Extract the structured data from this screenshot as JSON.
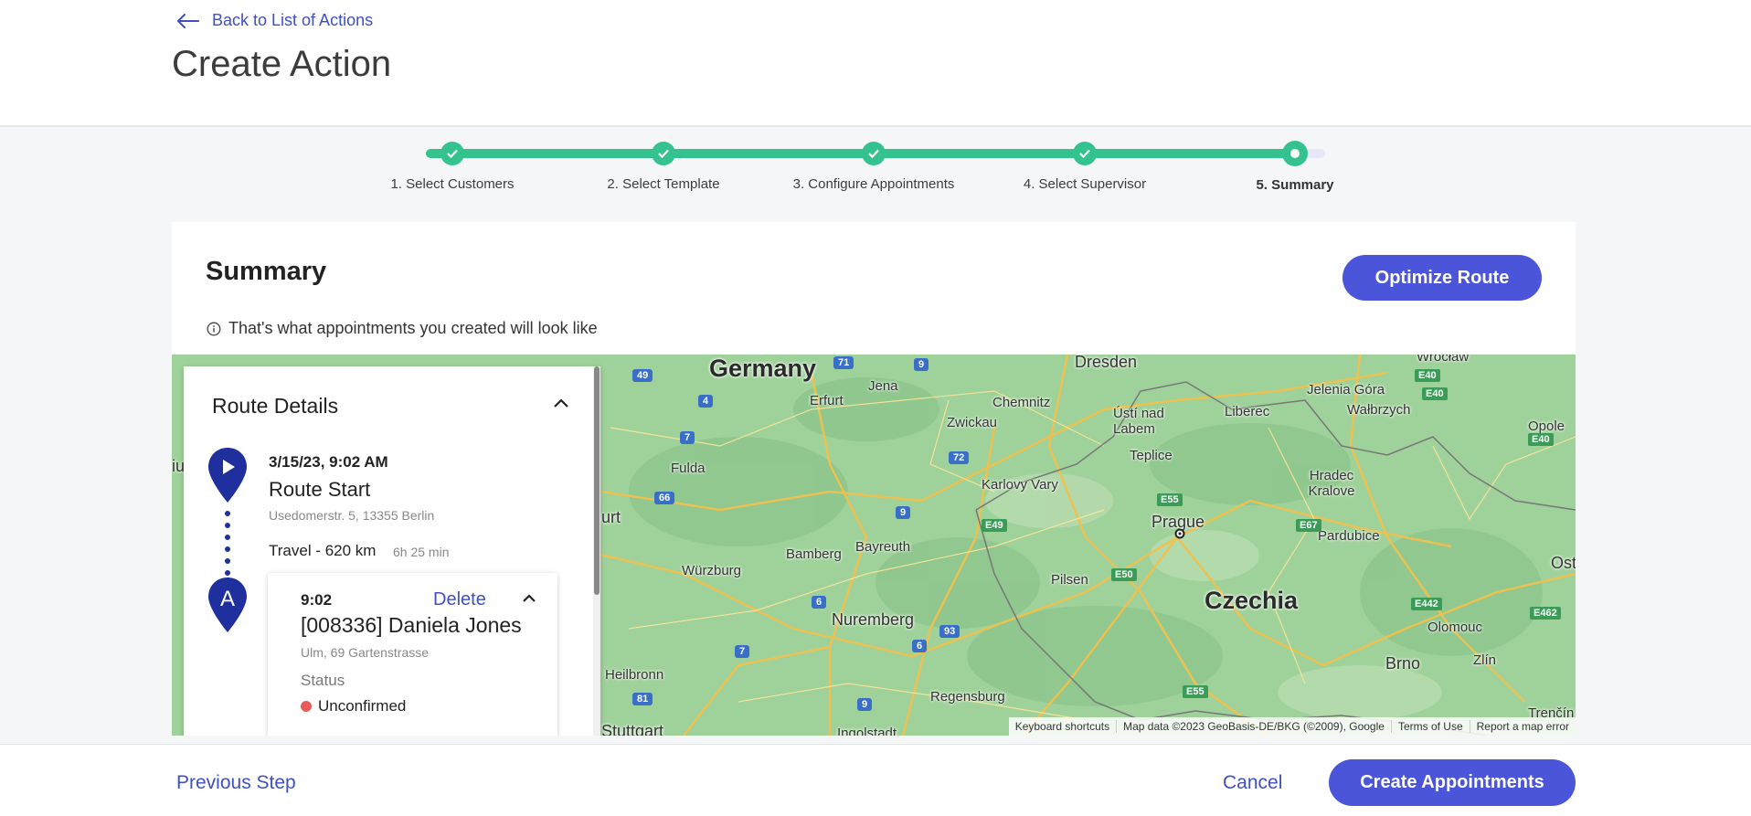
{
  "header": {
    "back_label": "Back to List of Actions",
    "title": "Create Action"
  },
  "stepper": {
    "steps": [
      {
        "label": "1. Select Customers",
        "state": "done"
      },
      {
        "label": "2. Select Template",
        "state": "done"
      },
      {
        "label": "3. Configure Appointments",
        "state": "done"
      },
      {
        "label": "4. Select Supervisor",
        "state": "done"
      },
      {
        "label": "5. Summary",
        "state": "current"
      }
    ]
  },
  "summary": {
    "title": "Summary",
    "info": "That's what appointments you created will look like",
    "optimize_label": "Optimize Route"
  },
  "route": {
    "title": "Route Details",
    "start": {
      "datetime": "3/15/23, 9:02 AM",
      "title": "Route Start",
      "address": "Usedomerstr. 5, 13355 Berlin"
    },
    "travel": {
      "label": "Travel - 620 km",
      "duration": "6h 25 min"
    },
    "appointment": {
      "marker": "A",
      "time": "9:02",
      "delete_label": "Delete",
      "name": "[008336] Daniela Jones",
      "address": "Ulm, 69 Gartenstrasse",
      "status_label": "Status",
      "status": "Unconfirmed",
      "status_color": "#e85b5b"
    }
  },
  "map": {
    "labels": {
      "germany": "Germany",
      "czechia": "Czechia",
      "prague": "Prague",
      "dresden": "Dresden",
      "wroclaw": "Wrocław",
      "erfurt": "Erfurt",
      "jena": "Jena",
      "chemnitz": "Chemnitz",
      "zwickau": "Zwickau",
      "usti": "Ústí nad Labem",
      "liberec": "Liberec",
      "jelenia": "Jelenia Góra",
      "walbrzych": "Wałbrzych",
      "opole": "Opole",
      "teplice": "Teplice",
      "fulda": "Fulda",
      "karlovy": "Karlovy Vary",
      "hradec": "Hradec Kralove",
      "pardubice": "Pardubice",
      "bamberg": "Bamberg",
      "bayreuth": "Bayreuth",
      "wurzburg": "Würzburg",
      "pilsen": "Pilsen",
      "nuremberg": "Nuremberg",
      "olomouc": "Olomouc",
      "heilbronn": "Heilbronn",
      "regensburg": "Regensburg",
      "brno": "Brno",
      "zlin": "Zlín",
      "stuttgart": "Stuttgart",
      "ingolstadt": "Ingolstadt",
      "trencin": "Trenčín",
      "ost": "Ost",
      "urt": "urt",
      "iu": "iu"
    },
    "shields": [
      "71",
      "9",
      "49",
      "4",
      "72",
      "9",
      "66",
      "7",
      "93",
      "6",
      "7",
      "81",
      "9",
      "6"
    ],
    "eshields": [
      "E40",
      "E40",
      "E40",
      "E55",
      "E49",
      "E67",
      "E50",
      "E442",
      "E462",
      "E55"
    ],
    "attribution": {
      "keyboard": "Keyboard shortcuts",
      "data": "Map data ©2023 GeoBasis-DE/BKG (©2009), Google",
      "terms": "Terms of Use",
      "report": "Report a map error"
    }
  },
  "footer": {
    "previous_label": "Previous Step",
    "cancel_label": "Cancel",
    "create_label": "Create Appointments"
  },
  "colors": {
    "accent": "#4a55d9",
    "step_done": "#34c38f",
    "pin": "#1f2f9e"
  }
}
